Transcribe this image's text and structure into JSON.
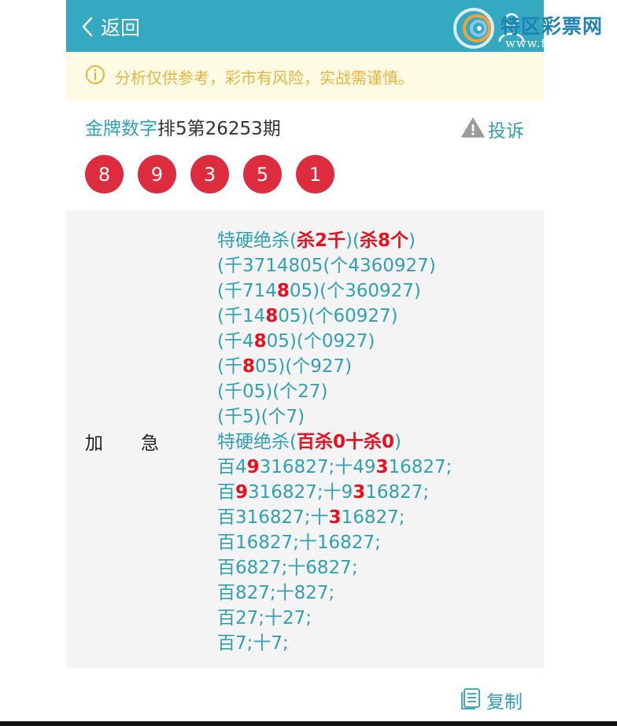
{
  "header": {
    "back_label": "返回"
  },
  "watermark": {
    "text": "特区彩票网",
    "url": "www.tqcp.net"
  },
  "notice": {
    "text": "分析仅供参考，彩市有风险，实战需谨慎。"
  },
  "title": {
    "source": "金牌数字",
    "rest": "排5第26253期"
  },
  "complain": {
    "label": "投诉"
  },
  "balls": [
    "8",
    "9",
    "3",
    "5",
    "1"
  ],
  "panel": {
    "label": "加急",
    "lines": [
      [
        {
          "t": "特硬绝杀("
        },
        {
          "t": "杀2千",
          "hl": true
        },
        {
          "t": ")("
        },
        {
          "t": "杀8个",
          "hl": true
        },
        {
          "t": ")"
        }
      ],
      [
        {
          "t": "(千37148"
        },
        {
          "t": ""
        },
        {
          "t": "05(个4360927)"
        }
      ],
      [
        {
          "t": "(千714"
        },
        {
          "t": "8",
          "hl": true
        },
        {
          "t": "05)(个360927)"
        }
      ],
      [
        {
          "t": "(千14"
        },
        {
          "t": "8",
          "hl": true
        },
        {
          "t": "05)(个60927)"
        }
      ],
      [
        {
          "t": "(千4"
        },
        {
          "t": "8",
          "hl": true
        },
        {
          "t": "05)(个0927)"
        }
      ],
      [
        {
          "t": "(千"
        },
        {
          "t": "8",
          "hl": true
        },
        {
          "t": "05)(个927)"
        }
      ],
      [
        {
          "t": "(千05)(个27)"
        }
      ],
      [
        {
          "t": "(千5)(个7)"
        }
      ],
      [
        {
          "t": "特硬绝杀("
        },
        {
          "t": "百杀0十杀0",
          "hl": true
        },
        {
          "t": ")"
        }
      ],
      [
        {
          "t": "百4"
        },
        {
          "t": "9",
          "hl": true
        },
        {
          "t": "316827;十49"
        },
        {
          "t": "3",
          "hl": true
        },
        {
          "t": "16827;"
        }
      ],
      [
        {
          "t": "百"
        },
        {
          "t": "9",
          "hl": true
        },
        {
          "t": "316827;十9"
        },
        {
          "t": "3",
          "hl": true
        },
        {
          "t": "16827;"
        }
      ],
      [
        {
          "t": "百316827;十"
        },
        {
          "t": "3",
          "hl": true
        },
        {
          "t": "16827;"
        }
      ],
      [
        {
          "t": "百16827;十16827;"
        }
      ],
      [
        {
          "t": "百6827;十6827;"
        }
      ],
      [
        {
          "t": "百827;十827;"
        }
      ],
      [
        {
          "t": "百27;十27;"
        }
      ],
      [
        {
          "t": "百7;十7;"
        }
      ]
    ]
  },
  "copy": {
    "label": "复制"
  },
  "colors": {
    "header_bg": "#35a9c1",
    "accent_text": "#2fa0b6",
    "ball": "#dc2c3e",
    "highlight": "#e8101e",
    "notice_bg": "#fefbe4",
    "notice_text": "#e9b342"
  },
  "icons": {
    "back": "chevron-left-icon",
    "user": "user-icon",
    "notice": "info-circle-icon",
    "complain": "warning-triangle-icon",
    "copy": "copy-document-icon"
  }
}
